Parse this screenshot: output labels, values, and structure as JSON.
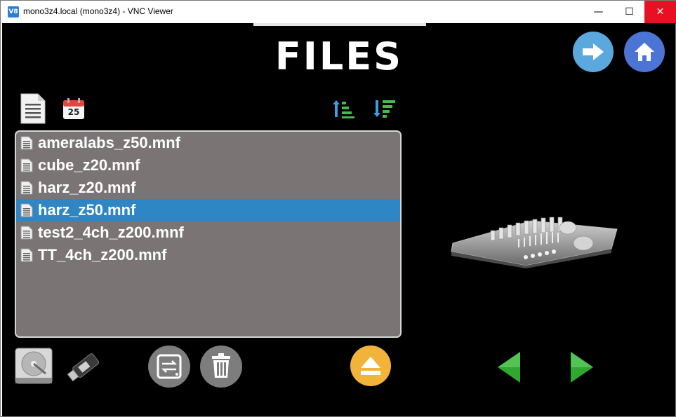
{
  "window": {
    "title": "mono3z4.local (mono3z4) - VNC Viewer",
    "app_icon_text": "V8",
    "minimize": "—",
    "maximize": "☐",
    "close": "✕"
  },
  "header": {
    "title": "FILES"
  },
  "view_options": {
    "calendar_day": "25"
  },
  "files": [
    {
      "name": "ameralabs_z50.mnf",
      "selected": false
    },
    {
      "name": "cube_z20.mnf",
      "selected": false
    },
    {
      "name": "harz_z20.mnf",
      "selected": false
    },
    {
      "name": "harz_z50.mnf",
      "selected": true
    },
    {
      "name": "test2_4ch_z200.mnf",
      "selected": false
    },
    {
      "name": "TT_4ch_z200.mnf",
      "selected": false
    }
  ],
  "colors": {
    "screen_bg": "#000000",
    "list_bg": "#7a7475",
    "selected_row": "#2e87c4",
    "next_button": "#5aa8dd",
    "home_button": "#4b74d4",
    "eject_button": "#f2b33a",
    "nav_arrow": "#2fa82f"
  },
  "icons": {
    "file": "document-icon",
    "sort_ascending": "sort-ascending-icon",
    "sort_descending": "sort-descending-icon",
    "internal_storage": "hard-drive-icon",
    "usb": "usb-drive-icon",
    "copy": "transfer-icon",
    "delete": "trash-icon",
    "eject": "eject-icon",
    "previous": "previous-arrow-icon",
    "next_page": "next-arrow-icon"
  }
}
